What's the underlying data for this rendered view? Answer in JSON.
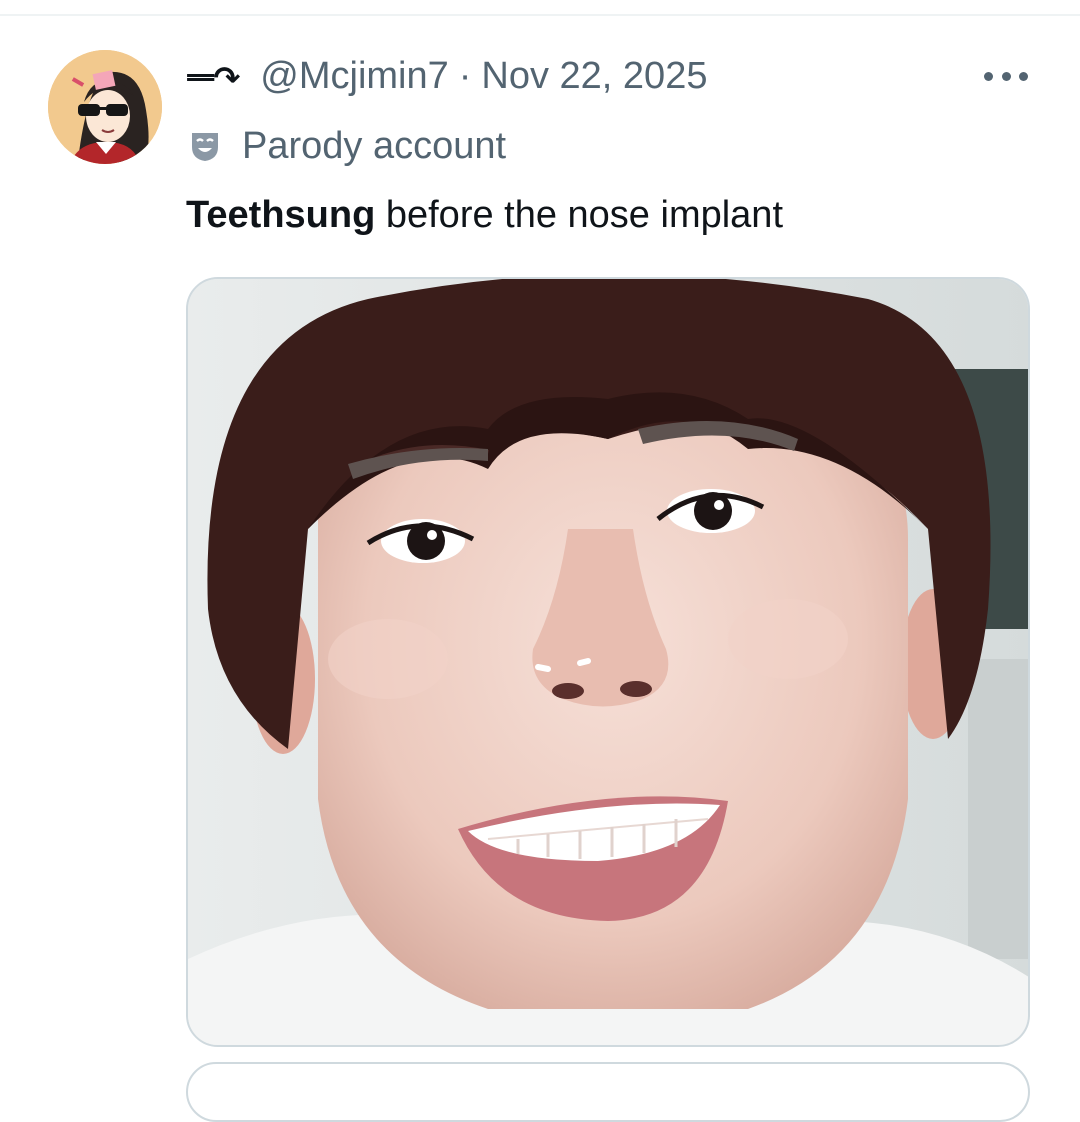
{
  "tweet": {
    "display_name": "ᆖ↷",
    "handle": "@Mcjimin7",
    "separator": "·",
    "date": "Nov 22, 2025",
    "label_icon": "parody-mask-icon",
    "label_text": "Parody account",
    "text_bold": "Teethsung",
    "text_rest": " before the nose implant",
    "more_icon": "more-horizontal-icon",
    "avatar_icon": "cartoon-avatar-icon",
    "media_description_icon": "photo-icon"
  },
  "colors": {
    "primary_text": "#0f1419",
    "secondary_text": "#536471",
    "border": "#cfd9de"
  }
}
